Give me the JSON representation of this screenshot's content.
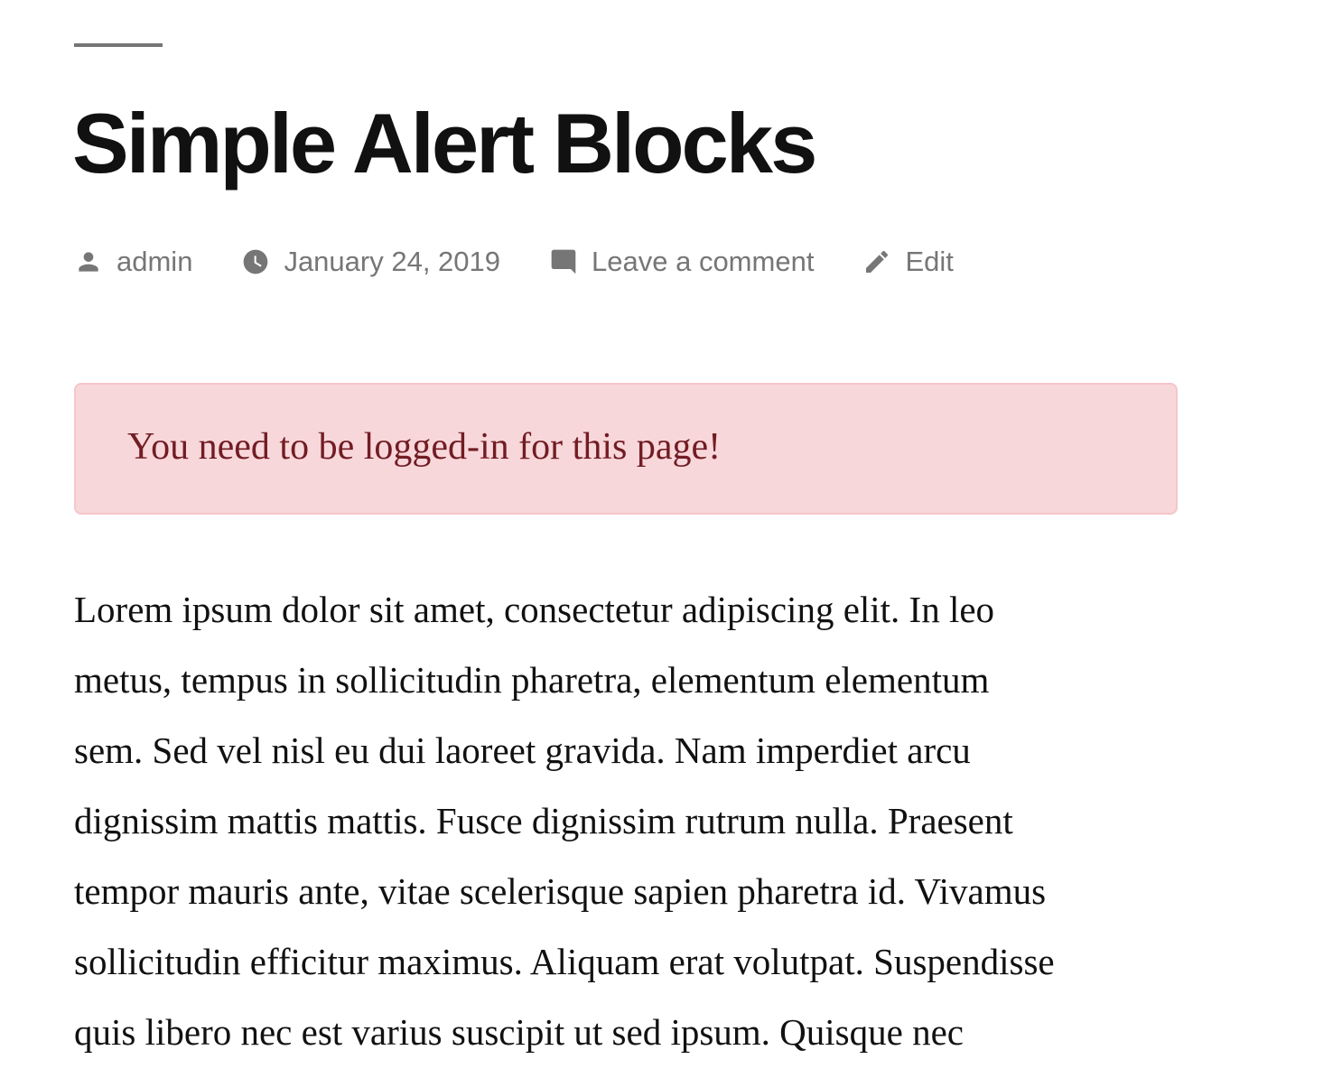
{
  "post": {
    "title": "Simple Alert Blocks",
    "meta": {
      "author": "admin",
      "date": "January 24, 2019",
      "comments": "Leave a comment",
      "edit": "Edit"
    },
    "alert": {
      "text": "You need to be logged-in for this page!",
      "background": "#f8d7da",
      "text_color": "#721c24"
    },
    "body_lines": [
      "Lorem ipsum dolor sit amet, consectetur adipiscing elit. In leo",
      "metus, tempus in sollicitudin pharetra, elementum elementum",
      "sem. Sed vel nisl eu dui laoreet gravida. Nam imperdiet arcu",
      "dignissim mattis mattis. Fusce dignissim rutrum nulla. Praesent",
      "tempor mauris ante, vitae scelerisque sapien pharetra id. Vivamus",
      "sollicitudin efficitur maximus. Aliquam erat volutpat. Suspendisse",
      "quis libero nec est varius suscipit ut sed ipsum. Quisque nec"
    ]
  },
  "icons": {
    "author": "person-icon",
    "date": "clock-icon",
    "comments": "comment-bubble-icon",
    "edit": "pencil-icon"
  }
}
